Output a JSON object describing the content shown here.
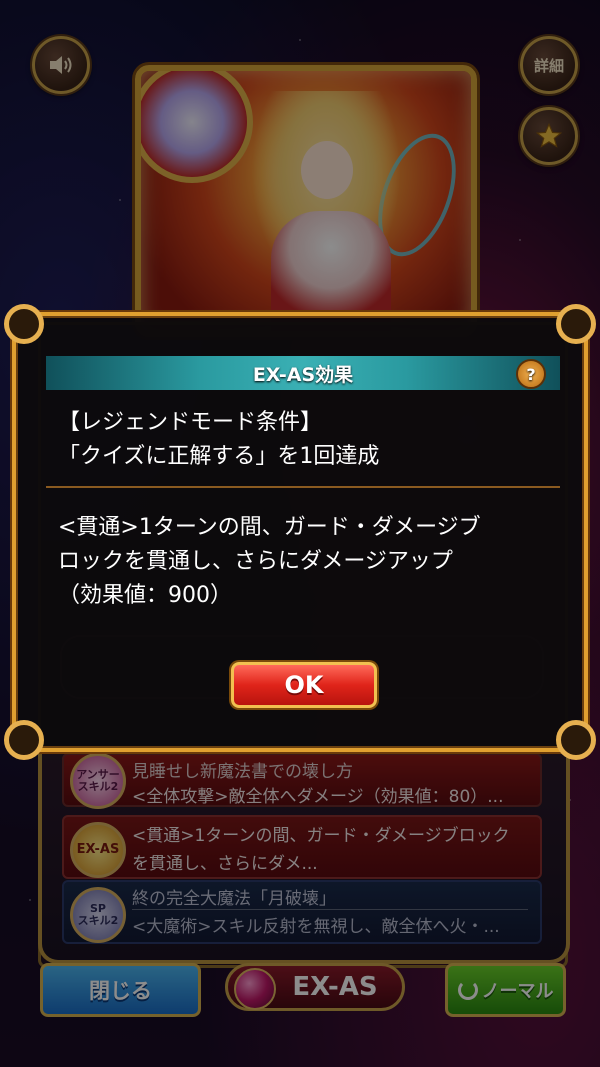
{
  "top_buttons": {
    "sound_icon": "speaker-icon",
    "details_label": "詳細",
    "favorite_icon": "star-icon"
  },
  "modal": {
    "title": "EX-AS効果",
    "help_label": "?",
    "condition_title": "【レジェンドモード条件】",
    "condition_text": "「クイズに正解する」を1回達成",
    "effect_lines": [
      "<貫通>1ターンの間、ガード・ダメージブ",
      "ロックを貫通し、さらにダメージアップ",
      "（効果値：900）"
    ],
    "ok_label": "OK"
  },
  "skills": [
    {
      "icon_label": "アンサー\nスキル2",
      "name": "見睡せし新魔法書での壊し方",
      "desc": "<全体攻撃>敵全体へダメージ（効果値：80）..."
    },
    {
      "icon_label": "EX-AS",
      "name": "<貫通>1ターンの間、ガード・ダメージブロック",
      "desc": "を貫通し、さらにダメ..."
    },
    {
      "icon_label": "SP\nスキル2",
      "name": "終の完全大魔法「月破壊」",
      "desc": "<大魔術>スキル反射を無視し、敵全体へ火・..."
    }
  ],
  "bottom_bar": {
    "close_label": "閉じる",
    "exas_label": "EX-AS",
    "normal_label": "ノーマル"
  },
  "colors": {
    "modal_border": "#e0a030",
    "header_teal": "#2a9aa0",
    "ok_red": "#e0241a",
    "close_blue": "#1a6ec8",
    "normal_green": "#2a8a10"
  }
}
